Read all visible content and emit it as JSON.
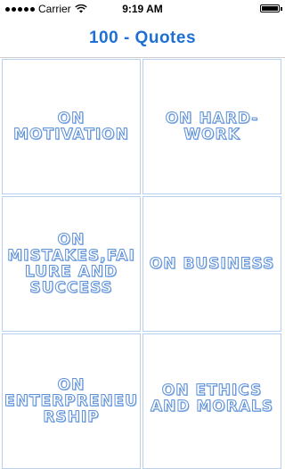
{
  "status_bar": {
    "carrier": "Carrier",
    "time": "9:19 AM",
    "battery_level": 1.0
  },
  "nav": {
    "title": "100 - Quotes"
  },
  "categories": [
    {
      "label": "ON MOTIVATION"
    },
    {
      "label": "ON HARD-WORK"
    },
    {
      "label": "ON MISTAKES,FAILURE AND SUCCESS"
    },
    {
      "label": "ON BUSINESS"
    },
    {
      "label": "ON ENTERPRENEURSHIP"
    },
    {
      "label": "ON ETHICS AND MORALS"
    }
  ],
  "colors": {
    "accent": "#1e6fd6",
    "cell_border": "#b8cfee",
    "label_outline": "#5b8fd8"
  }
}
